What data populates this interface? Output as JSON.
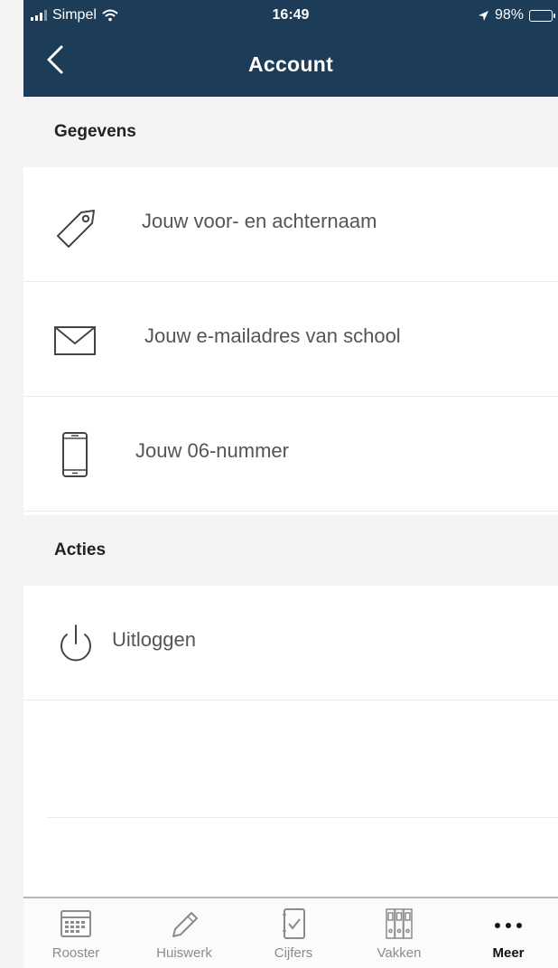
{
  "status_bar": {
    "carrier": "Simpel",
    "time": "16:49",
    "battery": "98%"
  },
  "header": {
    "title": "Account"
  },
  "sections": {
    "gegevens": {
      "title": "Gegevens",
      "name_label": "Jouw voor- en achternaam",
      "email_label": "Jouw e-mailadres van school",
      "phone_label": "Jouw 06-nummer"
    },
    "acties": {
      "title": "Acties",
      "logout_label": "Uitloggen"
    }
  },
  "tabbar": {
    "rooster": "Rooster",
    "huiswerk": "Huiswerk",
    "cijfers": "Cijfers",
    "vakken": "Vakken",
    "meer": "Meer"
  },
  "colors": {
    "header_bg": "#1d3c58",
    "battery": "#7ad35a",
    "active_tab": "#111111"
  }
}
